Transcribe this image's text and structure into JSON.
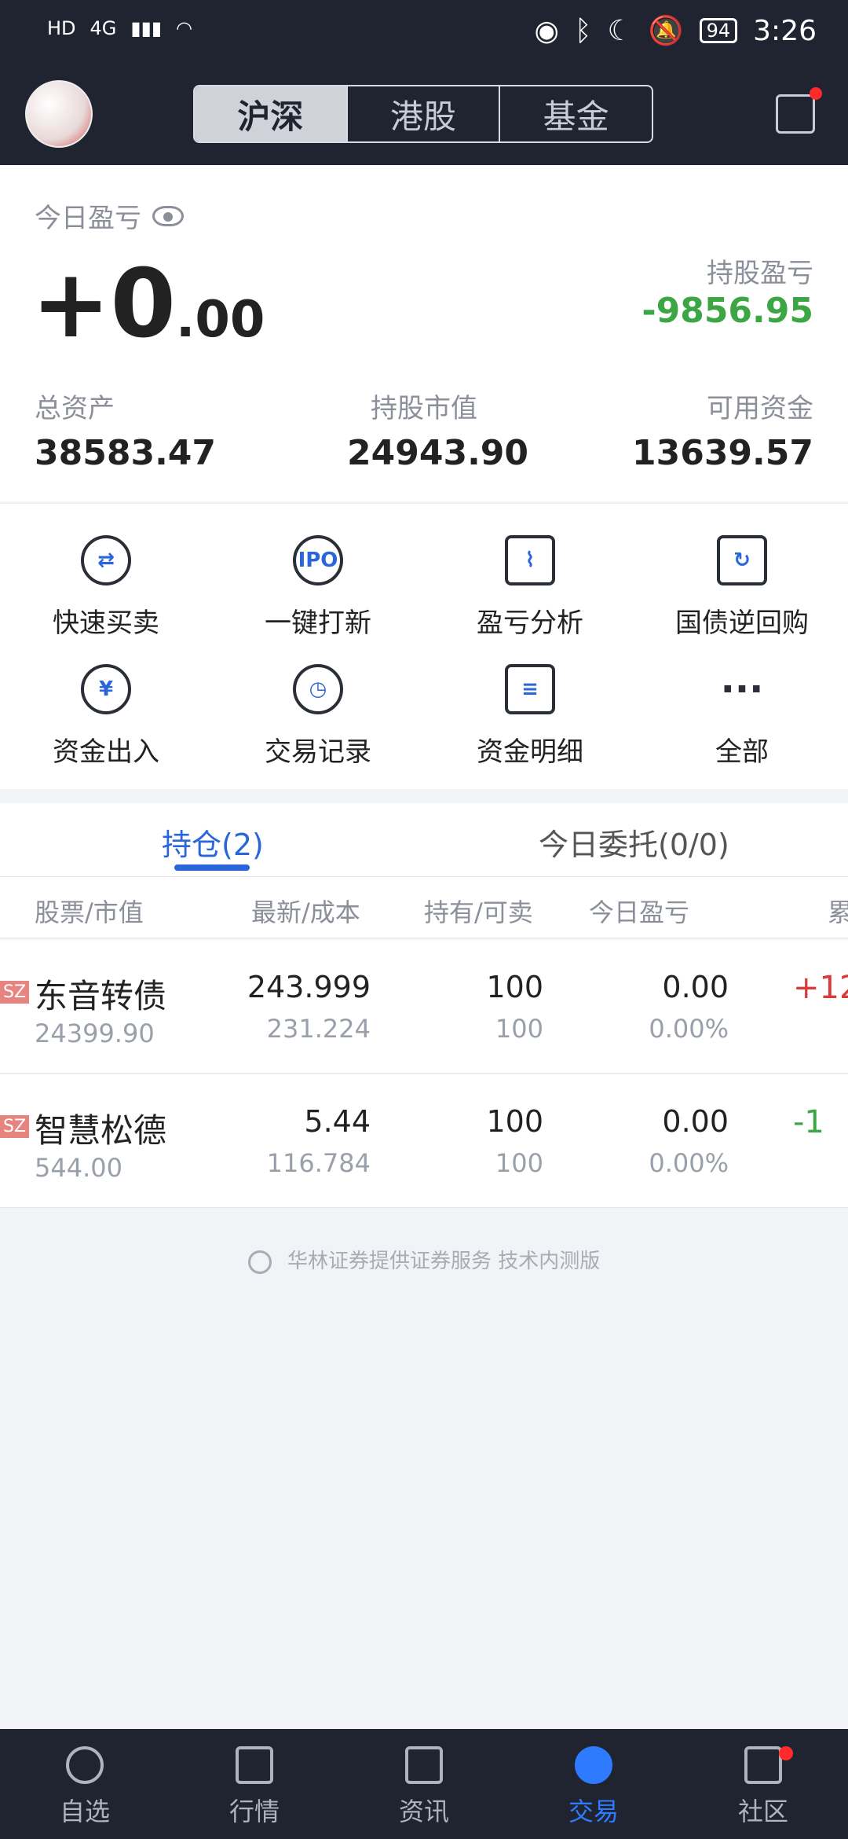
{
  "status_bar": {
    "left_items": [
      "HD",
      "4G",
      "signal",
      "wifi"
    ],
    "battery": "94",
    "time": "3:26"
  },
  "header": {
    "market_tabs": [
      {
        "label": "沪深",
        "active": true
      },
      {
        "label": "港股",
        "active": false
      },
      {
        "label": "基金",
        "active": false
      }
    ]
  },
  "summary": {
    "today_profit_label": "今日盈亏",
    "today_profit_int": "+0",
    "today_profit_dec": ".00",
    "holding_profit_label": "持股盈亏",
    "holding_profit_value": "-9856.95",
    "stats": [
      {
        "label": "总资产",
        "value": "38583.47"
      },
      {
        "label": "持股市值",
        "value": "24943.90"
      },
      {
        "label": "可用资金",
        "value": "13639.57"
      }
    ]
  },
  "actions": [
    {
      "label": "快速买卖",
      "icon": "exchange-icon"
    },
    {
      "label": "一键打新",
      "icon": "ipo-icon"
    },
    {
      "label": "盈亏分析",
      "icon": "chart-icon"
    },
    {
      "label": "国债逆回购",
      "icon": "bond-icon"
    },
    {
      "label": "资金出入",
      "icon": "transfer-icon"
    },
    {
      "label": "交易记录",
      "icon": "clock-icon"
    },
    {
      "label": "资金明细",
      "icon": "clipboard-icon"
    },
    {
      "label": "全部",
      "icon": "more-icon"
    }
  ],
  "tabs": {
    "positions": "持仓(2)",
    "orders": "今日委托(0/0)"
  },
  "table": {
    "headers": [
      "股票/市值",
      "最新/成本",
      "持有/可卖",
      "今日盈亏",
      "累"
    ],
    "rows": [
      {
        "market": "SZ",
        "name": "东音转债",
        "market_value": "24399.90",
        "latest": "243.999",
        "cost": "231.224",
        "hold": "100",
        "sellable": "100",
        "today_pl": "0.00",
        "today_pct": "0.00%",
        "cum": "+12"
      },
      {
        "market": "SZ",
        "name": "智慧松德",
        "market_value": "544.00",
        "latest": "5.44",
        "cost": "116.784",
        "hold": "100",
        "sellable": "100",
        "today_pl": "0.00",
        "today_pct": "0.00%",
        "cum": "-1"
      }
    ]
  },
  "footer_note": "华林证券提供证券服务 技术内测版",
  "bottom_nav": [
    {
      "label": "自选",
      "active": false
    },
    {
      "label": "行情",
      "active": false
    },
    {
      "label": "资讯",
      "active": false
    },
    {
      "label": "交易",
      "active": true
    },
    {
      "label": "社区",
      "active": false
    }
  ],
  "colors": {
    "header_bg": "#1f2430",
    "accent_blue": "#2a66d9",
    "loss_green": "#3ca645",
    "gain_red": "#d93a3a"
  }
}
